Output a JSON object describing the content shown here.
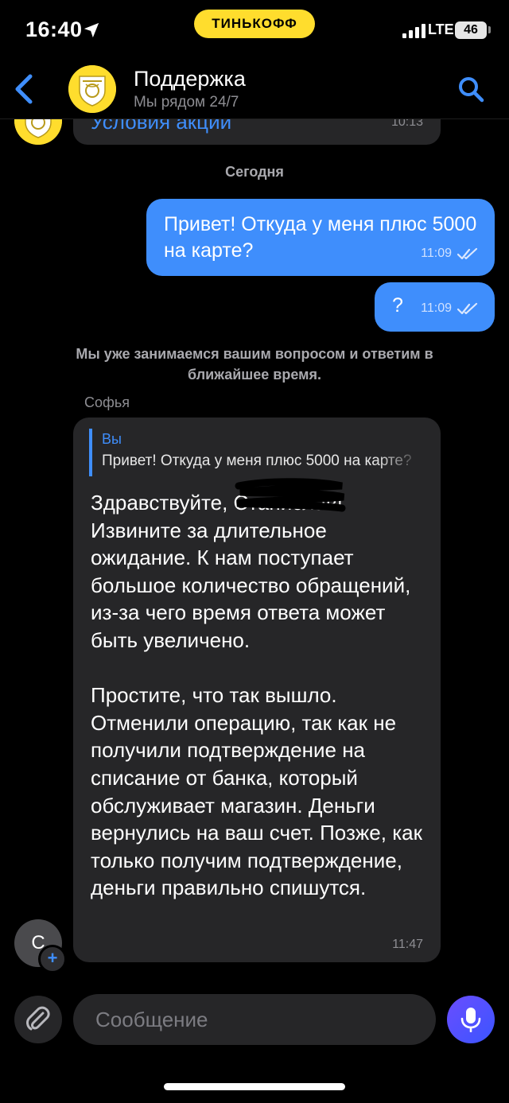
{
  "status_bar": {
    "time": "16:40",
    "brand": "ТИНЬКОФФ",
    "network": "LTE",
    "battery": "46"
  },
  "header": {
    "title": "Поддержка",
    "subtitle": "Мы рядом 24/7"
  },
  "chat": {
    "previous_message": {
      "text": "Условия акции",
      "time": "10:13"
    },
    "date_separator": "Сегодня",
    "outgoing": [
      {
        "text": "Привет! Откуда у меня плюс 5000 на карте?",
        "time": "11:09"
      },
      {
        "text": "?",
        "time": "11:09"
      }
    ],
    "system_note": "Мы уже занимаемся вашим вопросом и ответим в ближайшее время.",
    "sender_name": "Софья",
    "incoming": {
      "reply_author": "Вы",
      "reply_text": "Привет! Откуда у меня плюс 5000 на карте?",
      "paragraph_1": "Здравствуйте, Станислав! Извините за длительное ожидание. К нам поступает большое количество обращений, из-за чего время ответа может быть увеличено.",
      "paragraph_2": "Простите, что так вышло. Отменили операцию, так как не получили подтверждение на списание от банка, который обслуживает магазин. Деньги вернулись на ваш счет. Позже, как только получим подтверждение, деньги правильно спишутся.",
      "time": "11:47"
    },
    "agent_avatar_letter": "С",
    "agent_avatar_badge": "+"
  },
  "composer": {
    "placeholder": "Сообщение"
  },
  "colors": {
    "brand_yellow": "#FFDD2D",
    "accent_blue": "#3F8EFC",
    "bubble_dark": "#262628"
  }
}
